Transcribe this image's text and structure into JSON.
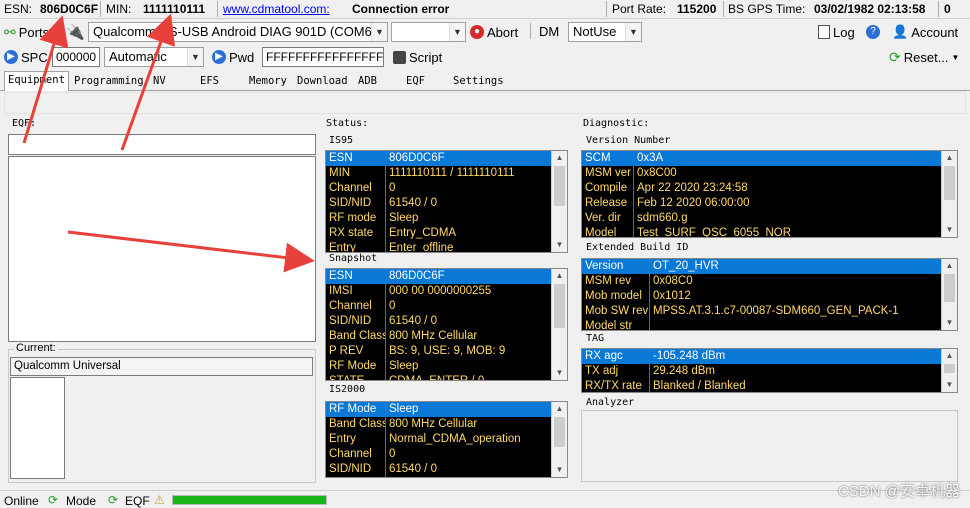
{
  "header": {
    "esn_label": "ESN:",
    "esn_value": "806D0C6F",
    "min_label": "MIN:",
    "min_value": "1111110111",
    "link": "www.cdmatool.com:",
    "conn_status": "Connection error",
    "port_rate_label": "Port Rate:",
    "port_rate_value": "115200",
    "gps_label": "BS GPS Time:",
    "gps_value": "03/02/1982 02:13:58",
    "counter": "0"
  },
  "toolbar1": {
    "ports_label": "Ports",
    "port_value": "Qualcomm HS-USB Android DIAG 901D (COM6",
    "abort_label": "Abort",
    "dm_label": "DM",
    "dm_value": "NotUse",
    "log_label": "Log",
    "account_label": "Account"
  },
  "toolbar2": {
    "spc_label": "SPC",
    "spc_value": "000000",
    "mode_value": "Automatic",
    "pwd_label": "Pwd",
    "pwd_value": "FFFFFFFFFFFFFFFF",
    "script_label": "Script",
    "reset_label": "Reset..."
  },
  "tabs": [
    "Equipment",
    "Programming",
    "NV",
    "EFS",
    "Memory",
    "Download",
    "ADB",
    "EQF",
    "Settings"
  ],
  "left": {
    "eqf_label": "EQF:",
    "current_label": "Current:",
    "current_value": "Qualcomm Universal"
  },
  "status": {
    "title": "Status:",
    "is95_title": "IS95",
    "is95": [
      {
        "k": "ESN",
        "v": "806D0C6F"
      },
      {
        "k": "MIN",
        "v": "1111110111 / 1111110111"
      },
      {
        "k": "Channel",
        "v": "0"
      },
      {
        "k": "SID/NID",
        "v": "61540 / 0"
      },
      {
        "k": "RF mode",
        "v": "Sleep"
      },
      {
        "k": "RX state",
        "v": "Entry_CDMA"
      },
      {
        "k": "Entry",
        "v": "Enter_offline"
      }
    ],
    "snapshot_title": "Snapshot",
    "snapshot": [
      {
        "k": "ESN",
        "v": "806D0C6F"
      },
      {
        "k": "IMSI",
        "v": "000 00 0000000255"
      },
      {
        "k": "Channel",
        "v": "0"
      },
      {
        "k": "SID/NID",
        "v": "61540 / 0"
      },
      {
        "k": "Band Class",
        "v": "800 MHz Cellular"
      },
      {
        "k": "P REV",
        "v": "BS: 9, USE: 9, MOB: 9"
      },
      {
        "k": "RF Mode",
        "v": "Sleep"
      },
      {
        "k": "STATE",
        "v": "CDMA_ENTER / 0"
      }
    ],
    "is2000_title": "IS2000",
    "is2000": [
      {
        "k": "RF Mode",
        "v": "Sleep"
      },
      {
        "k": "Band Class",
        "v": "800 MHz Cellular"
      },
      {
        "k": "Entry",
        "v": "Normal_CDMA_operation"
      },
      {
        "k": "Channel",
        "v": "0"
      },
      {
        "k": "SID/NID",
        "v": "61540 / 0"
      }
    ]
  },
  "diagnostic": {
    "title": "Diagnostic:",
    "version_title": "Version Number",
    "version": [
      {
        "k": "SCM",
        "v": "0x3A"
      },
      {
        "k": "MSM ver",
        "v": "0x8C00"
      },
      {
        "k": "Compile",
        "v": "Apr 22 2020 23:24:58"
      },
      {
        "k": "Release",
        "v": "Feb 12 2020 06:00:00"
      },
      {
        "k": "Ver. dir",
        "v": "sdm660.g"
      },
      {
        "k": "Model",
        "v": "Test_SURF_QSC_6055_NOR"
      }
    ],
    "ext_title": "Extended Build ID",
    "ext": [
      {
        "k": "Version",
        "v": "OT_20_HVR"
      },
      {
        "k": "MSM rev",
        "v": "0x08C0"
      },
      {
        "k": "Mob model",
        "v": "0x1012"
      },
      {
        "k": "Mob SW rev",
        "v": "MPSS.AT.3.1.c7-00087-SDM660_GEN_PACK-1"
      },
      {
        "k": "Model str",
        "v": ""
      }
    ],
    "tag_title": "TAG",
    "tag": [
      {
        "k": "RX agc",
        "v": "-105.248 dBm"
      },
      {
        "k": "TX adj",
        "v": "29.248 dBm"
      },
      {
        "k": "RX/TX rate",
        "v": "Blanked / Blanked"
      }
    ],
    "analyzer_title": "Analyzer"
  },
  "statusbar": {
    "online": "Online",
    "mode": "Mode",
    "eqf": "EQF",
    "watermark": "CSDN @安卓机器"
  },
  "colors": {
    "table_bg": "#000000",
    "table_text": "#ffd96a",
    "selected_row": "#0a78d7",
    "progress": "#1bb51b",
    "arrow": "#e8403a"
  }
}
